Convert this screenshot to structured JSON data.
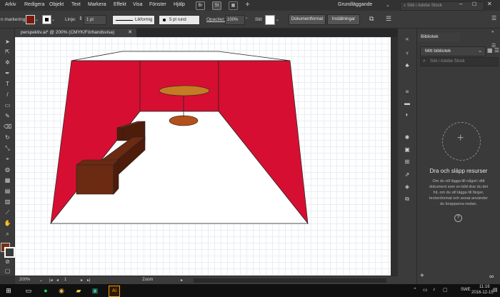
{
  "menu": {
    "items": [
      "Arkiv",
      "Redigera",
      "Objekt",
      "Text",
      "Markera",
      "Effekt",
      "Visa",
      "Fönster",
      "Hjälp"
    ],
    "br_icon": "Br",
    "st_icon": "St",
    "workspace": "Grundläggande",
    "stock_search_placeholder": "Sök i Adobe Stock"
  },
  "control": {
    "selection_label": "n markering",
    "stroke_label": "Linje:",
    "stroke_value": "1 pt",
    "profile_label": "Likformig",
    "brush_label": "5 pt rund",
    "opacity_label": "Opacitet:",
    "opacity_value": "100%",
    "style_label": "Stil:",
    "doc_format_button": "Dokumentformat",
    "settings_button": "Inställningar"
  },
  "document": {
    "tab_title": "perspektiv.ai* @ 200% (CMYK/Förhandsvisa)"
  },
  "status": {
    "zoom": "200%",
    "artboard": "1",
    "tool": "Zoom"
  },
  "library_panel": {
    "tab": "Bibliotek",
    "library_name": "Mitt bibliotek",
    "search_placeholder": "Sök i Adobe Stock",
    "drop_title": "Dra och släpp resurser",
    "drop_text": "Om du vill lägga till något i ditt dokument som en bild drar du det hit, om du vill lägga till färger, teckenformat och annat använder du knapparna nedan."
  },
  "taskbar": {
    "language": "SWE",
    "time": "11:16",
    "date": "2016-12-15"
  },
  "colors": {
    "wall": "#d60f32",
    "furniture": "#6b2a12",
    "furniture_dark": "#4e1c0a",
    "table": "#c77a24",
    "table_base": "#b4501c"
  }
}
